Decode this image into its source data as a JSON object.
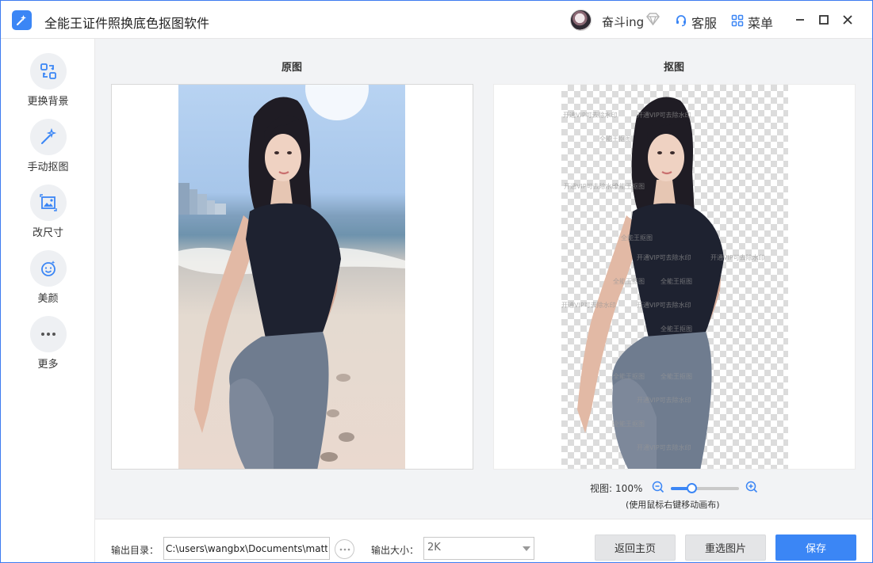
{
  "app": {
    "title": "全能王证件照换底色抠图软件",
    "username": "奋斗ing",
    "service_label": "客服",
    "menu_label": "菜单"
  },
  "sidebar": {
    "items": [
      {
        "label": "更换背景",
        "icon": "swap-background-icon"
      },
      {
        "label": "手动抠图",
        "icon": "magic-wand-icon"
      },
      {
        "label": "改尺寸",
        "icon": "resize-image-icon"
      },
      {
        "label": "美颜",
        "icon": "beauty-face-icon"
      },
      {
        "label": "更多",
        "icon": "more-dots-icon"
      }
    ]
  },
  "main": {
    "original_title": "原图",
    "cutout_title": "抠图",
    "watermark_a": "开通VIP可去除水印",
    "watermark_b": "全能王抠图",
    "zoom_label": "视图:",
    "zoom_value": "100%",
    "zoom_level": 0.3,
    "zoom_hint": "(使用鼠标右键移动画布)"
  },
  "bottom": {
    "output_dir_label": "输出目录：",
    "output_dir_value": "C:\\users\\wangbx\\Documents\\mattin",
    "output_size_label": "输出大小：",
    "output_size_value": "2K",
    "back_home": "返回主页",
    "reselect": "重选图片",
    "save": "保存"
  },
  "colors": {
    "accent": "#3b86f5",
    "panel_bg": "#f2f3f5"
  }
}
